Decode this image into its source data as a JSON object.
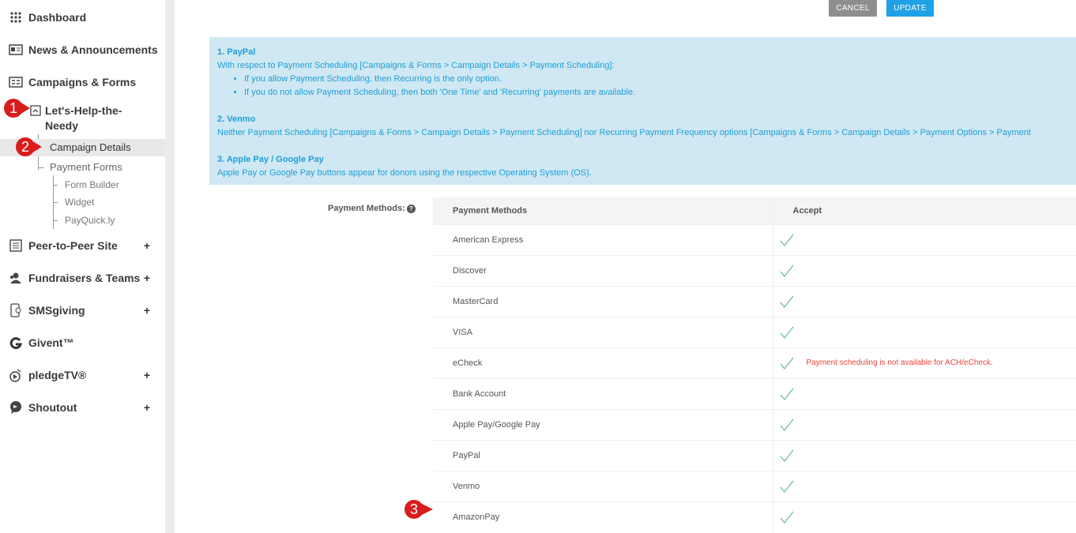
{
  "sidebar": {
    "items": [
      {
        "label": "Dashboard",
        "icon": "grid-icon"
      },
      {
        "label": "News & Announcements",
        "icon": "newspaper-icon"
      },
      {
        "label": "Campaigns & Forms",
        "icon": "form-icon"
      },
      {
        "label": "Peer-to-Peer Site",
        "icon": "site-icon",
        "expand": "+"
      },
      {
        "label": "Fundraisers & Teams",
        "icon": "team-icon",
        "expand": "+"
      },
      {
        "label": "SMSgiving",
        "icon": "phone-icon",
        "expand": "+"
      },
      {
        "label": "Givent™",
        "icon": "givent-icon"
      },
      {
        "label": "pledgeTV®",
        "icon": "tv-icon",
        "expand": "+"
      },
      {
        "label": "Shoutout",
        "icon": "chat-icon",
        "expand": "+"
      }
    ],
    "campaign": "Let's-Help-the-Needy",
    "campaign_details": "Campaign Details",
    "payment_forms": "Payment Forms",
    "form_builder": "Form Builder",
    "widget": "Widget",
    "payquickly": "PayQuick.ly"
  },
  "markers": [
    "1",
    "2",
    "3"
  ],
  "toolbar": {
    "cancel": "CANCEL",
    "update": "UPDATE"
  },
  "info": {
    "paypal_title": "1. PayPal",
    "paypal_text": "With respect to Payment Scheduling [Campaigns & Forms > Campaign Details > Payment Scheduling]:",
    "paypal_bullet1": "If you allow Payment Scheduling, then Recurring is the only option.",
    "paypal_bullet2": "If you do not allow Payment Scheduling, then both 'One Time' and 'Recurring' payments are available.",
    "venmo_title": "2. Venmo",
    "venmo_text": "Neither Payment Scheduling [Campaigns & Forms > Campaign Details > Payment Scheduling] nor Recurring Payment Frequency options [Campaigns & Forms > Campaign Details > Payment Options > Payment",
    "apple_title": "3. Apple Pay / Google Pay",
    "apple_text": "Apple Pay or Google Pay buttons appear for donors using the respective Operating System (OS)."
  },
  "payment_methods": {
    "label": "Payment Methods:",
    "help_icon": "?",
    "col_method": "Payment Methods",
    "col_accept": "Accept",
    "rows": [
      {
        "name": "American Express",
        "note": ""
      },
      {
        "name": "Discover",
        "note": ""
      },
      {
        "name": "MasterCard",
        "note": ""
      },
      {
        "name": "VISA",
        "note": ""
      },
      {
        "name": "eCheck",
        "note": "Payment scheduling is not available for ACH/eCheck."
      },
      {
        "name": "Bank Account",
        "note": ""
      },
      {
        "name": "Apple Pay/Google Pay",
        "note": ""
      },
      {
        "name": "PayPal",
        "note": ""
      },
      {
        "name": "Venmo",
        "note": ""
      },
      {
        "name": "AmazonPay",
        "note": ""
      }
    ]
  },
  "colors": {
    "accent": "#1fa1e6",
    "marker": "#d91c1c",
    "check": "#5cb88a",
    "warn": "#e8453c"
  }
}
